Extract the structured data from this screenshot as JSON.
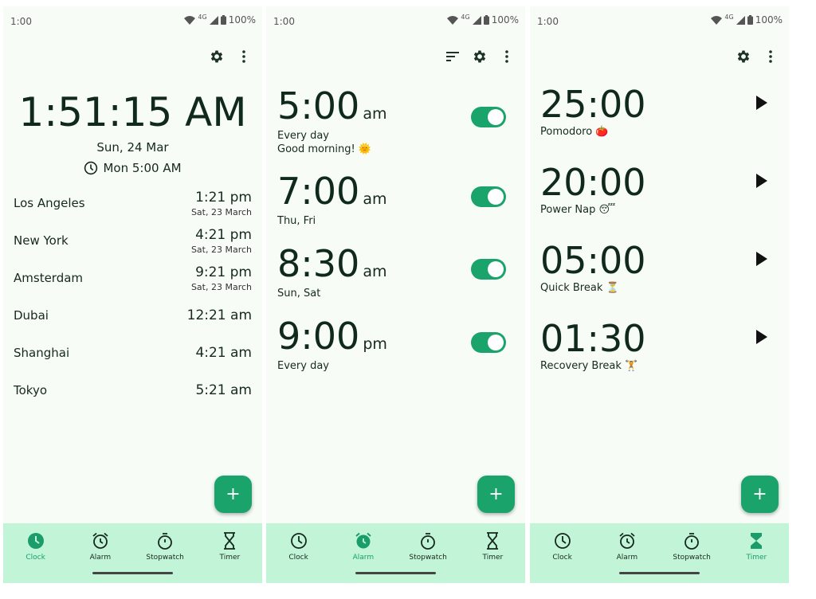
{
  "status_bar": {
    "time": "1:00",
    "network": "4G",
    "battery": "100%"
  },
  "nav": {
    "clock": "Clock",
    "alarm": "Alarm",
    "stopwatch": "Stopwatch",
    "timer": "Timer"
  },
  "fab_label": "+",
  "clock_screen": {
    "main_time": "1:51:15 AM",
    "date": "Sun, 24 Mar",
    "next_alarm": "Mon 5:00 AM",
    "cities": [
      {
        "name": "Los Angeles",
        "time": "1:21 pm",
        "date": "Sat, 23 March"
      },
      {
        "name": "New York",
        "time": "4:21 pm",
        "date": "Sat, 23 March"
      },
      {
        "name": "Amsterdam",
        "time": "9:21 pm",
        "date": "Sat, 23 March"
      },
      {
        "name": "Dubai",
        "time": "12:21 am",
        "date": ""
      },
      {
        "name": "Shanghai",
        "time": "4:21 am",
        "date": ""
      },
      {
        "name": "Tokyo",
        "time": "5:21 am",
        "date": ""
      }
    ]
  },
  "alarm_screen": {
    "alarms": [
      {
        "time": "5:00",
        "period": "am",
        "repeat": "Every day",
        "label": "Good morning! 🌞",
        "enabled": true
      },
      {
        "time": "7:00",
        "period": "am",
        "repeat": "Thu, Fri",
        "label": "",
        "enabled": true
      },
      {
        "time": "8:30",
        "period": "am",
        "repeat": "Sun, Sat",
        "label": "",
        "enabled": true
      },
      {
        "time": "9:00",
        "period": "pm",
        "repeat": "Every day",
        "label": "",
        "enabled": true
      }
    ]
  },
  "timer_screen": {
    "timers": [
      {
        "time": "25:00",
        "label": "Pomodoro 🍅"
      },
      {
        "time": "20:00",
        "label": "Power Nap 😴"
      },
      {
        "time": "05:00",
        "label": "Quick Break ⏳"
      },
      {
        "time": "01:30",
        "label": "Recovery Break 🏋"
      }
    ]
  },
  "colors": {
    "accent": "#1aa36b",
    "nav_bg": "#c2f5d8",
    "screen_bg": "#f8fcf7",
    "text": "#16291d"
  },
  "icons": [
    "gear-icon",
    "more-vert-icon",
    "sort-icon",
    "clock-icon",
    "alarm-icon",
    "stopwatch-icon",
    "hourglass-icon",
    "play-icon",
    "wifi-icon",
    "signal-icon",
    "battery-icon"
  ]
}
